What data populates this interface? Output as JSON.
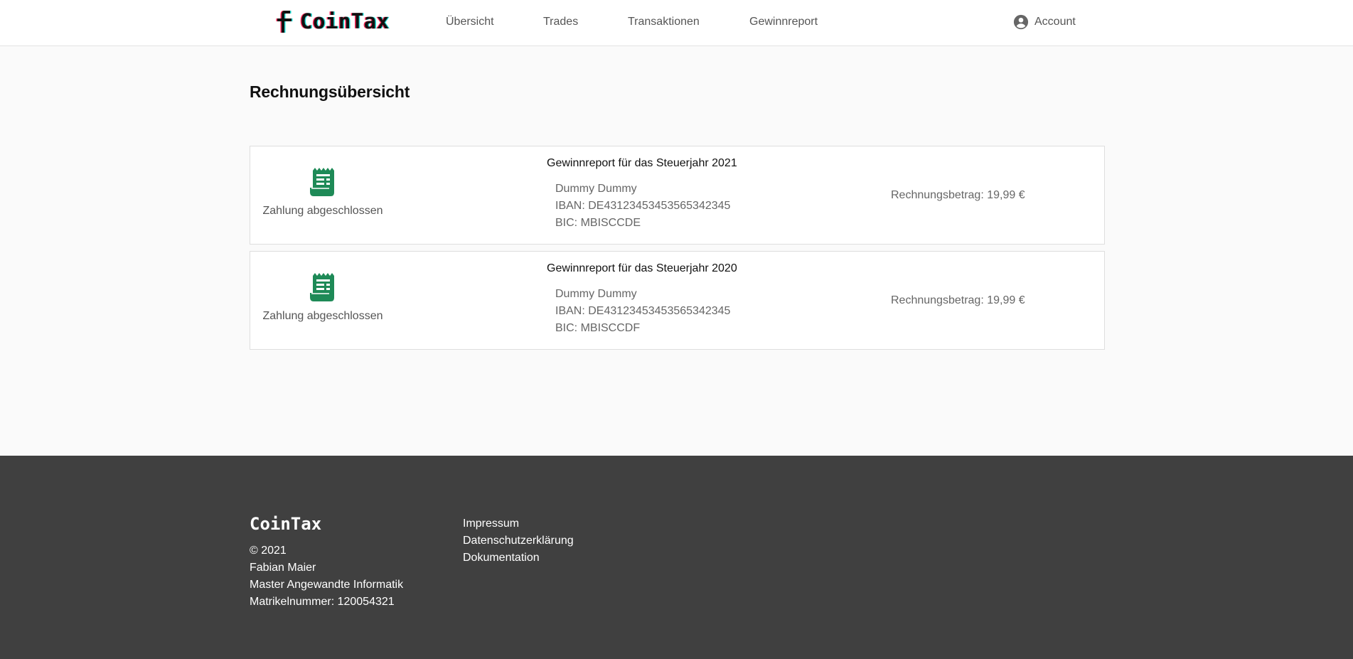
{
  "header": {
    "brand": "CoinTax",
    "nav": [
      {
        "label": "Übersicht"
      },
      {
        "label": "Trades"
      },
      {
        "label": "Transaktionen"
      },
      {
        "label": "Gewinnreport"
      }
    ],
    "account_label": "Account",
    "account_icon": "account-circle-icon",
    "logo_colors": {
      "primary": "#111111",
      "accent_red": "#ff2a5a",
      "accent_cyan": "#1fd8d2"
    }
  },
  "main": {
    "title": "Rechnungsübersicht",
    "invoices": [
      {
        "status_icon": "receipt-icon",
        "status": "Zahlung abgeschlossen",
        "title": "Gewinnreport für das Steuerjahr 2021",
        "name": "Dummy Dummy",
        "iban": "IBAN: DE43123453453565342345",
        "bic": "BIC: MBISCCDE",
        "amount": "Rechnungsbetrag: 19,99 €"
      },
      {
        "status_icon": "receipt-icon",
        "status": "Zahlung abgeschlossen",
        "title": "Gewinnreport für das Steuerjahr 2020",
        "name": "Dummy Dummy",
        "iban": "IBAN: DE43123453453565342345",
        "bic": "BIC: MBISCCDF",
        "amount": "Rechnungsbetrag: 19,99 €"
      }
    ],
    "success_color": "#1e8a57"
  },
  "footer": {
    "brand": "CoinTax",
    "copyright": "© 2021",
    "author": "Fabian Maier",
    "program": "Master Angewandte Informatik",
    "matrikel": "Matrikelnummer: 120054321",
    "links": [
      {
        "label": "Impressum"
      },
      {
        "label": "Datenschutzerklärung"
      },
      {
        "label": "Dokumentation"
      }
    ],
    "background": "#404040"
  }
}
